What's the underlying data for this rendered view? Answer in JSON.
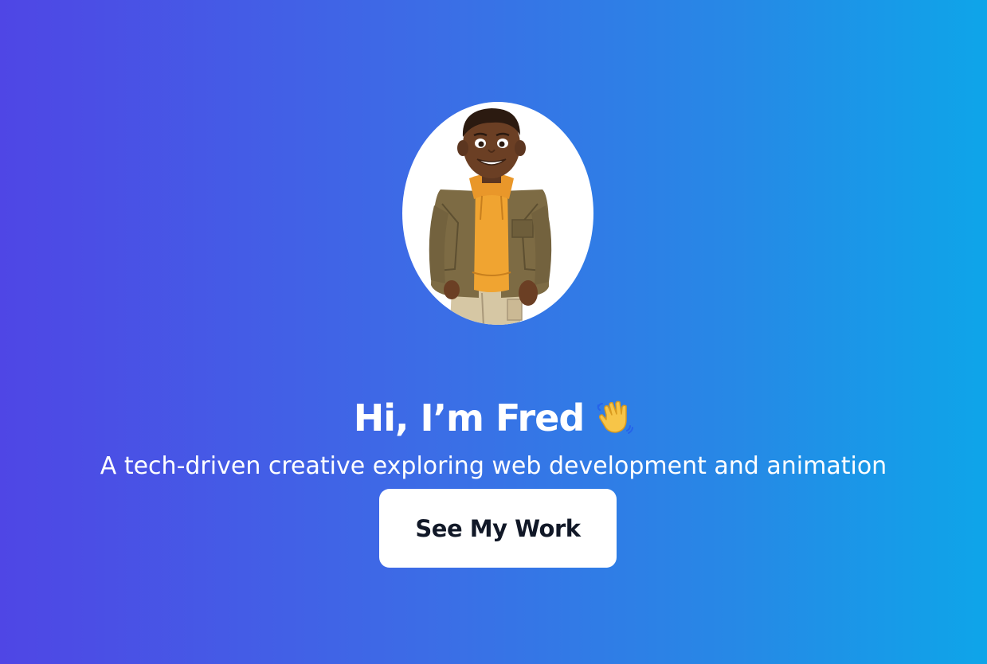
{
  "hero": {
    "avatar_alt": "Illustrated portrait of Fred",
    "headline": "Hi, I’m Fred",
    "headline_icon": "waving-hand-icon",
    "subtitle": "A tech-driven creative exploring web development and animation",
    "cta_label": "See My Work"
  },
  "colors": {
    "gradient_start": "#4f46e5",
    "gradient_end": "#0ea5e9",
    "button_bg": "#ffffff",
    "button_text": "#111827",
    "text": "#ffffff"
  }
}
